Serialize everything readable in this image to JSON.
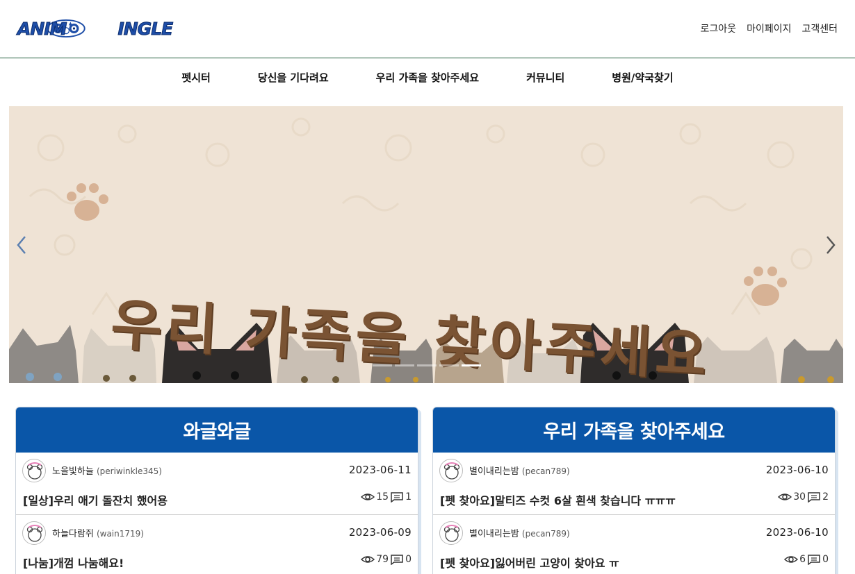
{
  "header": {
    "logo_left": "ANIM",
    "logo_right": "INGLE",
    "links": [
      "로그아웃",
      "마이페이지",
      "고객센터"
    ]
  },
  "nav": {
    "items": [
      "펫시터",
      "당신을 기다려요",
      "우리 가족을 찾아주세요",
      "커뮤니티",
      "병원/약국찾기"
    ]
  },
  "banner": {
    "title": "우리 가족을 찾아주세요",
    "slide_count": 5,
    "active_slide": 5,
    "background_color": "#efe3d5",
    "text_color": "#7a5333"
  },
  "cards": [
    {
      "title": "와글와글",
      "posts": [
        {
          "author": "노을빛하늘",
          "user_id": "(periwinkle345)",
          "date": "2023-06-11",
          "title": "[일상]우리 애기 돌잔치 했어용",
          "views": "15",
          "comments": "1"
        },
        {
          "author": "하늘다람쥐",
          "user_id": "(wain1719)",
          "date": "2023-06-09",
          "title": "[나눔]개껌 나눔해요!",
          "views": "79",
          "comments": "0"
        }
      ]
    },
    {
      "title": "우리 가족을 찾아주세요",
      "posts": [
        {
          "author": "별이내리는밤",
          "user_id": "(pecan789)",
          "date": "2023-06-10",
          "title": "[펫 찾아요]말티즈 수컷 6살 흰색 찾습니다 ㅠㅠㅠ",
          "views": "30",
          "comments": "2"
        },
        {
          "author": "별이내리는밤",
          "user_id": "(pecan789)",
          "date": "2023-06-10",
          "title": "[펫 찾아요]잃어버린 고양이 찾아요 ㅠ",
          "views": "6",
          "comments": "0"
        }
      ]
    }
  ],
  "colors": {
    "brand_blue": "#0a56a8",
    "header_border": "#1e5b3a"
  }
}
